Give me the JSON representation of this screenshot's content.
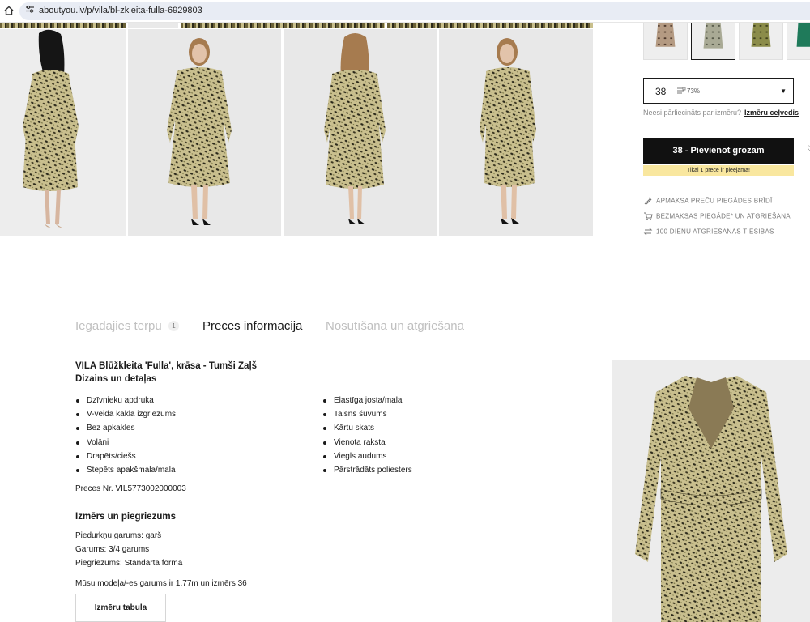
{
  "browser": {
    "url": "aboutyou.lv/p/vila/bl-zkleita-fulla-6929803"
  },
  "gallery": {
    "photos": [
      {
        "name": "model-back-view"
      },
      {
        "name": "model-front-view"
      },
      {
        "name": "model-back-view-2"
      },
      {
        "name": "model-side-view"
      }
    ]
  },
  "colors": {
    "accent_black": "#111111",
    "stock_note_bg": "#f9e79f",
    "pattern_dark": "#2c2a1a",
    "pattern_light": "#c8bf8c"
  },
  "purchase": {
    "selected_size": "38",
    "fit_percent": "73%",
    "size_hint": "Neesi pārliecināts par izmēru?",
    "size_guide_link": "Izmēru ceļvedis",
    "add_to_cart": "38 - Pievienot grozam",
    "stock_note": "Tikai 1 prece ir pieejama!",
    "perks": [
      {
        "icon": "payment-icon",
        "label": "APMAKSA PREČU PIEGĀDES BRĪDĪ"
      },
      {
        "icon": "cart-delivery-icon",
        "label": "BEZMAKSAS PIEGĀDE* UN ATGRIEŠANA"
      },
      {
        "icon": "return-arrows-icon",
        "label": "100 DIENU ATGRIEŠANAS TIESĪBAS"
      }
    ]
  },
  "tabs": [
    {
      "label": "Iegādājies tērpu",
      "count": "1"
    },
    {
      "label": "Preces informācija"
    },
    {
      "label": "Nosūtīšana un atgriešana"
    }
  ],
  "product": {
    "title": "VILA Blūžkleita 'Fulla', krāsa - Tumši Zaļš",
    "design_heading": "Dizains un detaļas",
    "features_left": [
      "Dzīvnieku apdruka",
      "V-veida kakla izgriezums",
      "Bez apkakles",
      "Volāni",
      "Drapēts/ciešs",
      "Stepēts apakšmala/mala"
    ],
    "features_right": [
      "Elastīga josta/mala",
      "Taisns šuvums",
      "Kārtu skats",
      "Vienota raksta",
      "Viegls audums",
      "Pārstrādāts poliesters"
    ],
    "article_no": "Preces Nr. VIL5773002000003",
    "size_heading": "Izmērs un piegriezums",
    "fit_lines": [
      "Piedurkņu garums: garš",
      "Garums: 3/4 garums",
      "Piegriezums: Standarta forma",
      "Mūsu modeļa/-es garums ir 1.77m un izmērs 36"
    ],
    "size_table_button": "Izmēru tabula"
  }
}
